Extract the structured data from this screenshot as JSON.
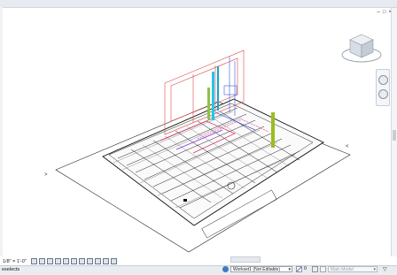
{
  "view": {
    "scale": "1/8\" = 1'-0\"",
    "window_controls": [
      "–",
      "□",
      "×"
    ]
  },
  "status_bar": {
    "text": "eselects",
    "workset": "Workset1 (Not Editable)",
    "editable_only": "0",
    "model": "Main Model"
  },
  "icons": [
    "minimize-icon",
    "restore-icon",
    "close-icon",
    "viewcube-icon",
    "steering-wheel-icon",
    "zoom-icon",
    "workset-icon",
    "filter-icon"
  ]
}
